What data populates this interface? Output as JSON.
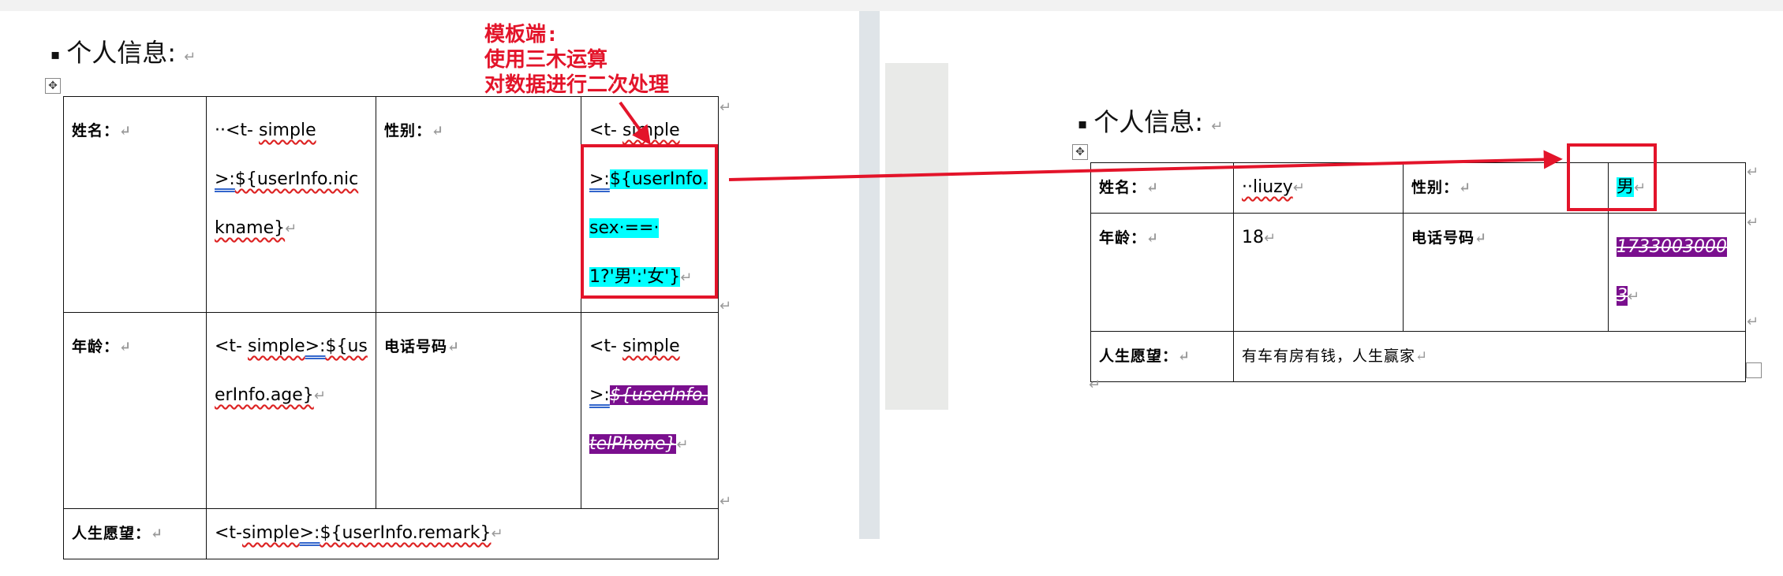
{
  "left_doc": {
    "heading": "个人信息:",
    "rows": [
      {
        "label1": "姓名：",
        "value1_prefix": "··<t-",
        "value1_simple": "simple",
        "value1_op": ">:",
        "value1_expr": "${userInfo.nickname}",
        "label2": "性别：",
        "value2_prefix": "<t-",
        "value2_simple": "simple",
        "value2_op": ">:",
        "value2_expr": "${userInfo.sex·==·1?'男':'女'}"
      },
      {
        "label1": "年龄：",
        "value1_prefix": "<t-",
        "value1_simple": "simple",
        "value1_op": ">:",
        "value1_expr": "${userInfo.age}",
        "label2": "电话号码",
        "value2_prefix": "<t-",
        "value2_simple": "simple",
        "value2_op": ">:",
        "value2_expr": "${userInfo.telPhone}"
      },
      {
        "label1": "人生愿望：",
        "value1_prefix": "<t-",
        "value1_simple": "simple",
        "value1_op": ">:",
        "value1_expr": "${userInfo.remark}"
      }
    ]
  },
  "annotation": {
    "line1": "模板端:",
    "line2": "使用三木运算",
    "line3": "对数据进行二次处理"
  },
  "right_doc": {
    "heading": "个人信息:",
    "rows": [
      {
        "label1": "姓名：",
        "value1": "··liuzy",
        "label2": "性别：",
        "value2": "男"
      },
      {
        "label1": "年龄：",
        "value1": "18",
        "label2": "电话号码",
        "value2": "17330030003"
      },
      {
        "label1": "人生愿望：",
        "value1": "有车有房有钱，人生赢家"
      }
    ]
  },
  "paragraph_mark": "↵",
  "move_handle_icon": "✥",
  "colors": {
    "annotation_red": "#e3142a",
    "highlight_cyan": "#00ffff",
    "highlight_purple": "#7a0f8e"
  }
}
